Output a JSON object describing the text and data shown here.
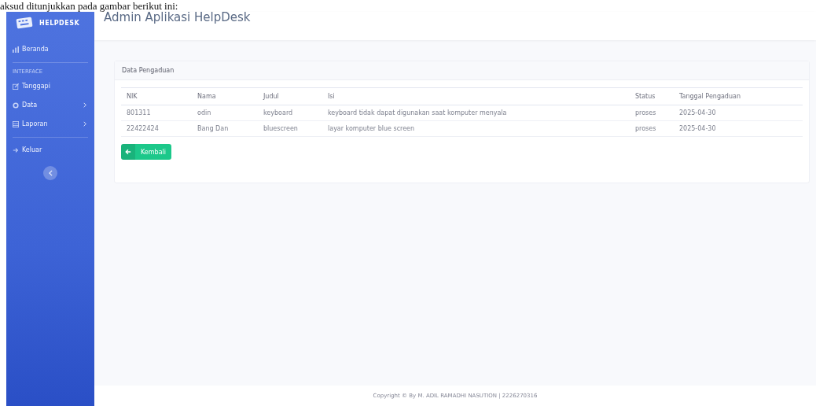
{
  "caption": "aksud ditunjukkan pada gambar berikut ini:",
  "brand": "HELPDESK",
  "header_title": "Admin Aplikasi HelpDesk",
  "sidebar": {
    "items": [
      {
        "kind": "link",
        "label": "Beranda"
      },
      {
        "kind": "divider"
      },
      {
        "kind": "heading",
        "label": "INTERFACE"
      },
      {
        "kind": "link",
        "label": "Tanggapi"
      },
      {
        "kind": "menu",
        "label": "Data"
      },
      {
        "kind": "menu",
        "label": "Laporan"
      },
      {
        "kind": "divider"
      },
      {
        "kind": "link",
        "label": "Keluar"
      }
    ]
  },
  "card": {
    "title": "Data Pengaduan",
    "table": {
      "columns": [
        "NIK",
        "Nama",
        "Judul",
        "Isi",
        "Status",
        "Tanggal Pengaduan"
      ],
      "rows": [
        [
          "801311",
          "odin",
          "keyboard",
          "keyboard tidak dapat digunakan saat komputer menyala",
          "proses",
          "2025-04-30"
        ],
        [
          "22422424",
          "Bang Dan",
          "bluescreen",
          "layar komputer blue screen",
          "proses",
          "2025-04-30"
        ]
      ]
    },
    "back_button": "Kembali"
  },
  "footer": "Copyright © By M. ADIL RAMADHI NASUTION | 2226270316"
}
